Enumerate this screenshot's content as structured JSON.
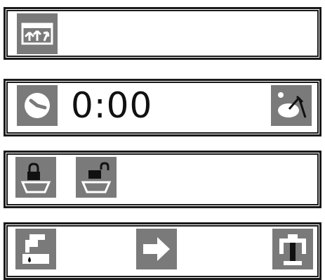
{
  "panels": [
    {
      "id": "top-panel",
      "buttons": [
        {
          "icon": "fullscreen-expand-icon"
        }
      ]
    },
    {
      "id": "timer-panel",
      "time_value": "0:00",
      "buttons": [
        {
          "icon": "clock-icon"
        },
        {
          "icon": "analog-clock-hand-icon"
        }
      ]
    },
    {
      "id": "lock-panel",
      "buttons": [
        {
          "icon": "lock-tray-icon"
        },
        {
          "icon": "unlock-tray-icon"
        }
      ]
    },
    {
      "id": "action-panel",
      "buttons": [
        {
          "icon": "faucet-drop-icon"
        },
        {
          "icon": "arrow-right-icon"
        },
        {
          "icon": "tool-stand-icon"
        }
      ]
    }
  ],
  "colors": {
    "button_bg": "#7a7a7a",
    "icon_fg": "#ffffff",
    "border": "#1a1a1a",
    "text": "#111111"
  }
}
